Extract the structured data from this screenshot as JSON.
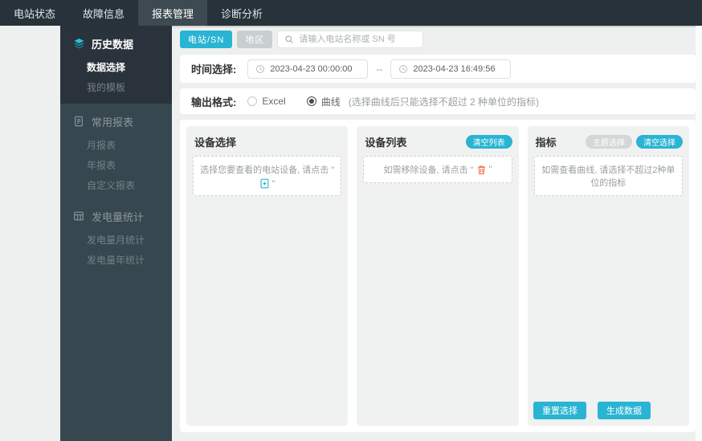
{
  "navbar": {
    "tabs": [
      {
        "label": "电站状态"
      },
      {
        "label": "故障信息"
      },
      {
        "label": "报表管理"
      },
      {
        "label": "诊断分析"
      }
    ]
  },
  "sidebar": {
    "groups": [
      {
        "title": "历史数据",
        "icon": "layers-icon",
        "children": [
          {
            "label": "数据选择"
          },
          {
            "label": "我的模板"
          }
        ]
      },
      {
        "title": "常用报表",
        "icon": "report-icon",
        "children": [
          {
            "label": "月报表"
          },
          {
            "label": "年报表"
          },
          {
            "label": "自定义报表"
          }
        ]
      },
      {
        "title": "发电量统计",
        "icon": "grid-icon",
        "children": [
          {
            "label": "发电量月统计"
          },
          {
            "label": "发电量年统计"
          }
        ]
      }
    ]
  },
  "filters": {
    "station_sn_button": "电站/SN",
    "region_button": "地区",
    "search_placeholder": "请输入电站名称或 SN 号",
    "search_icon": "search-icon"
  },
  "time": {
    "label": "时间选择:",
    "start": "2023-04-23 00:00:00",
    "separator": "--",
    "end": "2023-04-23 16:49:56",
    "clock_icon": "clock-icon"
  },
  "format": {
    "label": "输出格式:",
    "options": [
      {
        "label": "Excel",
        "checked": false
      },
      {
        "label": "曲线",
        "checked": true
      }
    ],
    "note": "(选择曲线后只能选择不超过 2 种单位的指标)"
  },
  "panels": {
    "device_select": {
      "title": "设备选择",
      "hint_prefix": "选择您要查看的电站设备, 请点击 \"",
      "hint_icon": "add-file-icon",
      "hint_suffix": "\""
    },
    "device_list": {
      "title": "设备列表",
      "clear_button": "清空列表",
      "hint_prefix": "如需移除设备, 请点击 \"",
      "hint_icon": "trash-icon",
      "hint_suffix": "\""
    },
    "indicators": {
      "title": "指标",
      "theme_button": "主题选择",
      "clear_button": "清空选择",
      "hint": "如需查看曲线, 请选择不超过2种单位的指标"
    }
  },
  "actions": {
    "reset": "重置选择",
    "generate": "生成数据"
  },
  "colors": {
    "accent": "#29b4d3",
    "orange": "#f0764a",
    "navbar_bg": "#28323a",
    "sidebar_bg": "#37474f",
    "active_group_bg": "#2a333b",
    "page_bg": "#eef0ef"
  }
}
